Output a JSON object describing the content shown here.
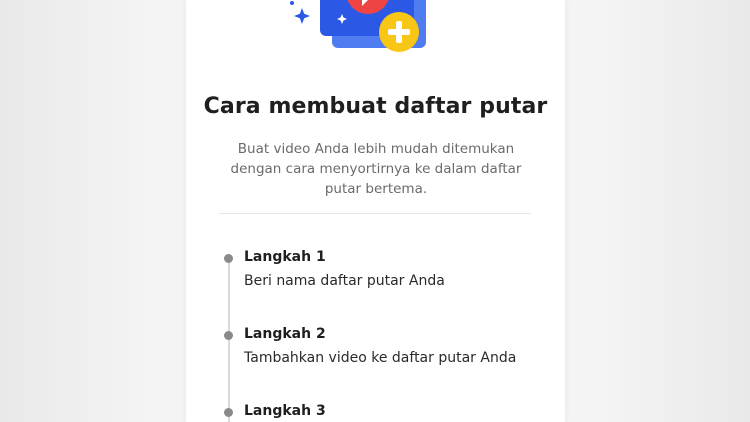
{
  "colors": {
    "background": "#efefef",
    "panel": "#ffffff",
    "title_text": "#1f1f1f",
    "description_text": "#6b6b6b",
    "timeline_dot": "#8a8a8a",
    "illustration_blue": "#2b59e6",
    "illustration_red": "#ef4444",
    "illustration_yellow": "#f8c614"
  },
  "illustration": {
    "icon": "playlist-add-icon"
  },
  "title": "Cara membuat daftar putar",
  "description": "Buat video Anda lebih mudah ditemukan dengan cara menyortirnya ke dalam daftar putar bertema.",
  "steps": [
    {
      "title": "Langkah 1",
      "text": "Beri nama daftar putar Anda"
    },
    {
      "title": "Langkah 2",
      "text": "Tambahkan video ke daftar putar Anda"
    },
    {
      "title": "Langkah 3",
      "text": ""
    }
  ]
}
